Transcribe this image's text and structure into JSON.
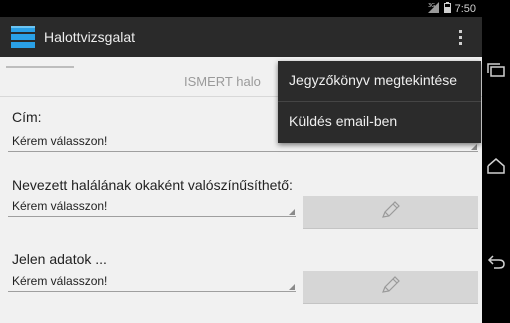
{
  "status_bar": {
    "time": "7:50"
  },
  "action_bar": {
    "title": "Halottvizsgalat"
  },
  "tab": {
    "label": "ISMERT halo"
  },
  "form": {
    "address": {
      "label": "Cím:",
      "value": "Kérem válasszon!"
    },
    "cause": {
      "label": "Nevezett halálának okaként valószínűsíthető:",
      "value": "Kérem válasszon!"
    },
    "current": {
      "label": "Jelen adatok ...",
      "value": "Kérem válasszon!"
    }
  },
  "overflow_menu": {
    "items": [
      {
        "label": "Jegyzőkönyv megtekintése"
      },
      {
        "label": "Küldés email-ben"
      }
    ]
  },
  "colors": {
    "action_bar": "#2a2a2a",
    "app_icon": "#2aa0e6",
    "menu_bg": "#2b2b2b",
    "content_bg": "#f1f1f1"
  }
}
